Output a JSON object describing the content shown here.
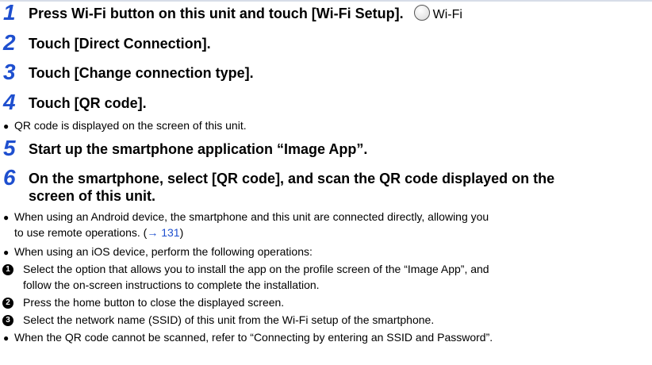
{
  "steps": [
    {
      "num": "1",
      "text": "Press Wi-Fi button on this unit and touch [Wi-Fi Setup].",
      "wifi_label": "Wi-Fi"
    },
    {
      "num": "2",
      "text": "Touch [Direct Connection]."
    },
    {
      "num": "3",
      "text": "Touch [Change connection type]."
    },
    {
      "num": "4",
      "text": "Touch [QR code]."
    },
    {
      "num": "5",
      "text": "Start up the smartphone application “Image App”."
    },
    {
      "num": "6",
      "text_line1": "On the smartphone, select [QR code], and scan the QR code displayed on the",
      "text_line2": "screen of this unit."
    }
  ],
  "notes": {
    "step4_bullet": "QR code is displayed on the screen of this unit.",
    "android_line1": "When using an Android device, the smartphone and this unit are connected directly, allowing you",
    "android_line2_prefix": "to use remote operations. (",
    "android_link": "→ 131",
    "android_line2_suffix": ")",
    "ios": "When using an iOS device, perform the following operations:",
    "ios_steps": [
      {
        "marker": "1",
        "line1": "Select the option that allows you to install the app on the profile screen of the “Image App”, and",
        "line2": "follow the on-screen instructions to complete the installation."
      },
      {
        "marker": "2",
        "line1": "Press the home button to close the displayed screen."
      },
      {
        "marker": "3",
        "line1": "Select the network name (SSID) of this unit from the Wi-Fi setup of the smartphone."
      }
    ],
    "qr_fail": "When the QR code cannot be scanned, refer to “Connecting by entering an SSID and Password”."
  }
}
